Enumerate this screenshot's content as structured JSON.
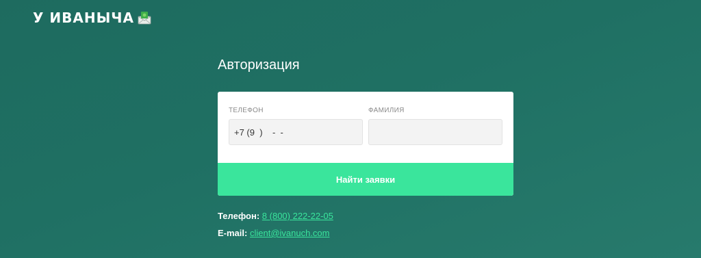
{
  "brand": {
    "logo_text": "У ИВАНЫЧА",
    "logo_icon": "envelope-money-icon"
  },
  "form": {
    "title": "Авторизация",
    "phone_label": "ТЕЛЕФОН",
    "phone_value": "+7 (9  )    -  -",
    "surname_label": "ФАМИЛИЯ",
    "surname_value": "",
    "submit_label": "Найти заявки"
  },
  "contacts": {
    "phone_label": "Телефон:",
    "phone_value": "8 (800) 222-22-05",
    "email_label": "E-mail:",
    "email_value": "client@ivanuch.com"
  },
  "colors": {
    "background": "#1f7063",
    "accent": "#3ae59c",
    "card": "#ffffff"
  }
}
